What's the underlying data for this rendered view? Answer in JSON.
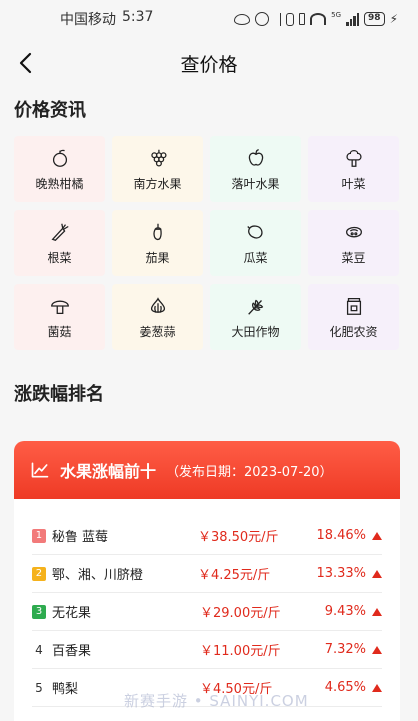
{
  "status_bar": {
    "carrier": "中国移动",
    "time": "5:37",
    "network": "5G",
    "battery": "98",
    "icons": [
      "eye-icon",
      "alarm-icon",
      "bluetooth-icon",
      "vibrate-icon",
      "nfc-icon",
      "wifi-icon",
      "signal-icon",
      "battery-icon",
      "charging-icon"
    ]
  },
  "nav": {
    "title": "查价格",
    "back_icon": "back-arrow-icon"
  },
  "price_info": {
    "title": "价格资讯",
    "categories": [
      {
        "label": "晚熟柑橘",
        "icon": "citrus-icon"
      },
      {
        "label": "南方水果",
        "icon": "grapes-icon"
      },
      {
        "label": "落叶水果",
        "icon": "apple-icon"
      },
      {
        "label": "叶菜",
        "icon": "leafy-vegetable-icon"
      },
      {
        "label": "根菜",
        "icon": "carrot-icon"
      },
      {
        "label": "茄果",
        "icon": "eggplant-icon"
      },
      {
        "label": "瓜菜",
        "icon": "melon-icon"
      },
      {
        "label": "菜豆",
        "icon": "bean-icon"
      },
      {
        "label": "菌菇",
        "icon": "mushroom-icon"
      },
      {
        "label": "姜葱蒜",
        "icon": "garlic-icon"
      },
      {
        "label": "大田作物",
        "icon": "wheat-icon"
      },
      {
        "label": "化肥农资",
        "icon": "fertilizer-icon"
      }
    ]
  },
  "ranking": {
    "title": "涨跌幅排名",
    "card": {
      "title": "水果涨幅前十",
      "date": "（发布日期：2023-07-20）",
      "icon": "trend-chart-icon",
      "rows": [
        {
          "rank": "1",
          "name": "秘鲁 蓝莓",
          "price": "￥38.50元/斤",
          "pct": "18.46%"
        },
        {
          "rank": "2",
          "name": "鄂、湘、川脐橙",
          "price": "￥4.25元/斤",
          "pct": "13.33%"
        },
        {
          "rank": "3",
          "name": "无花果",
          "price": "￥29.00元/斤",
          "pct": "9.43%"
        },
        {
          "rank": "4",
          "name": "百香果",
          "price": "￥11.00元/斤",
          "pct": "7.32%"
        },
        {
          "rank": "5",
          "name": "鸭梨",
          "price": "￥4.50元/斤",
          "pct": "4.65%"
        }
      ]
    }
  },
  "watermark": "新赛手游 • SAINYI.COM",
  "colors": {
    "accent": "#ee3a25",
    "rise": "#e02a1c",
    "rank1": "#f27a7a",
    "rank2": "#f5b21c",
    "rank3": "#2eab4f"
  }
}
